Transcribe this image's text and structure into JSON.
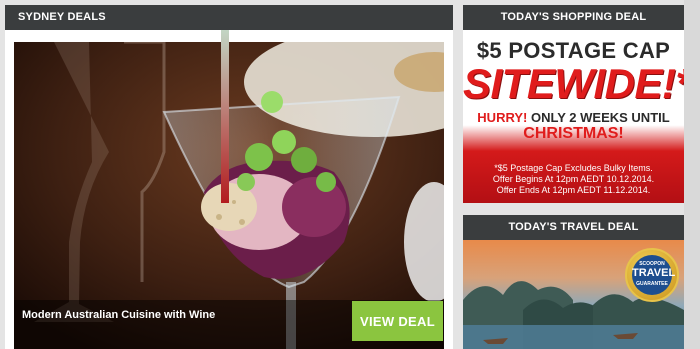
{
  "left_panel": {
    "header": "SYDNEY DEALS",
    "deal_title": "Modern Australian Cuisine with Wine",
    "cta_label": "VIEW DEAL"
  },
  "shopping_panel": {
    "header": "TODAY'S SHOPPING DEAL",
    "headline": "$5 POSTAGE CAP",
    "highlight": "SITEWIDE!*",
    "hurry_prefix": "HURRY!",
    "hurry_rest": "ONLY 2 WEEKS UNTIL",
    "christmas": "CHRISTMAS!",
    "fine_print_1": "*$5 Postage Cap Excludes Bulky Items.",
    "fine_print_2": "Offer Begins At 12pm AEDT 10.12.2014.",
    "fine_print_3": "Offer Ends At 12pm AEDT 11.12.2014."
  },
  "travel_panel": {
    "header": "TODAY'S TRAVEL DEAL",
    "badge_top": "SCOOPON",
    "badge_mid": "TRAVEL",
    "badge_bot": "GUARANTEE"
  },
  "colors": {
    "header_bg": "#3a3d3e",
    "cta_green": "#8bc53f",
    "promo_red": "#e01c1c"
  }
}
